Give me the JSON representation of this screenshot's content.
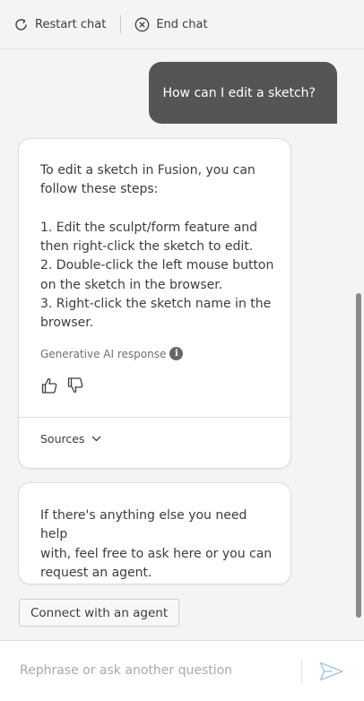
{
  "header": {
    "restart_label": "Restart chat",
    "restart_icon": "refresh-icon",
    "end_label": "End chat",
    "end_icon": "close-circle-icon"
  },
  "messages": {
    "user_question": "How can I edit a sketch?",
    "bot_answer": {
      "intro_line1": "To edit a sketch in Fusion, you can",
      "intro_line2": "follow these steps:",
      "step1_line1": "1. Edit the sculpt/form feature and",
      "step1_line2": "then right-click the sketch to edit.",
      "step2_line1": "2. Double-click the left mouse button",
      "step2_line2": "on the sketch in the browser.",
      "step3_line1": "3. Right-click the sketch name in the",
      "step3_line2": "browser.",
      "ai_label": "Generative AI response",
      "info_glyph": "i",
      "sources_label": "Sources"
    },
    "followup": {
      "line1": "If there's anything else you need help",
      "line2": "with, feel free to ask here or you can",
      "line3": "request an agent."
    }
  },
  "agent_button_label": "Connect with an agent",
  "composer": {
    "placeholder": "Rephrase or ask another question",
    "send_icon": "send-icon"
  },
  "colors": {
    "user_bubble": "#555555",
    "background": "#f4f4f4",
    "card": "#ffffff",
    "send_icon": "#9fc3e8"
  }
}
